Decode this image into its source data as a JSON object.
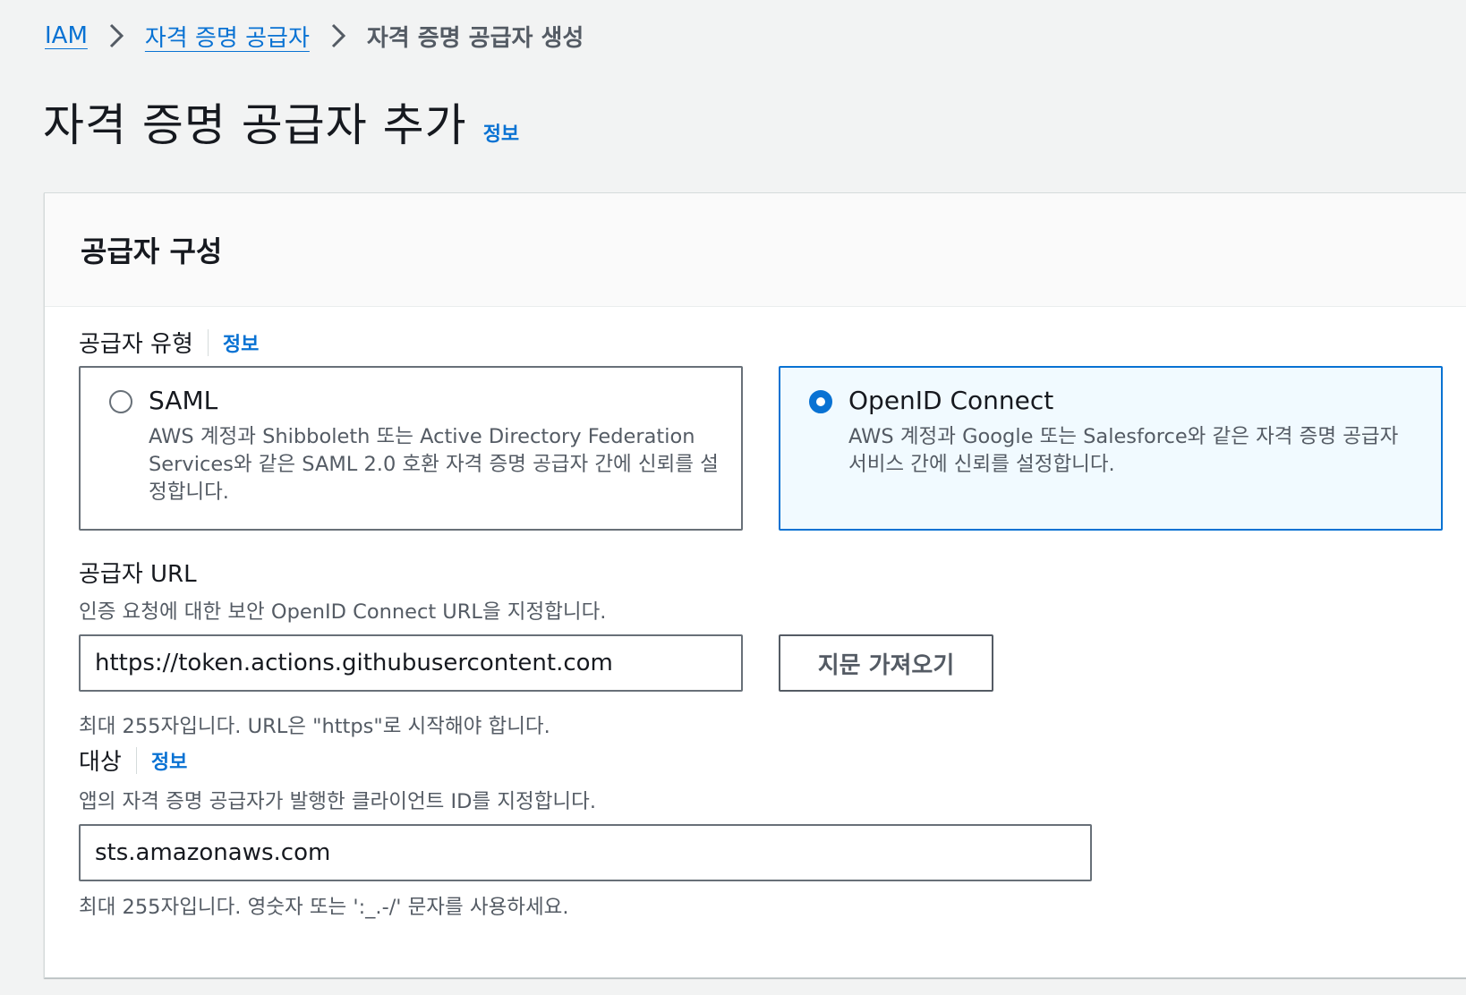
{
  "breadcrumb": {
    "items": [
      {
        "label": "IAM"
      },
      {
        "label": "자격 증명 공급자"
      }
    ],
    "current": "자격 증명 공급자 생성"
  },
  "page": {
    "title": "자격 증명 공급자 추가",
    "info_label": "정보"
  },
  "panel": {
    "title": "공급자 구성"
  },
  "provider_type": {
    "label": "공급자 유형",
    "info_label": "정보",
    "selected": "OpenID Connect",
    "options": [
      {
        "title": "SAML",
        "desc_line1": "AWS 계정과 Shibboleth 또는 Active Directory Federation",
        "desc_line2": "Services와 같은 SAML 2.0 호환 자격 증명 공급자 간에 신뢰를 설",
        "desc_line3": "정합니다."
      },
      {
        "title": "OpenID Connect",
        "desc_line1": "AWS 계정과 Google 또는 Salesforce와 같은 자격 증명 공급자",
        "desc_line2": "서비스 간에 신뢰를 설정합니다."
      }
    ]
  },
  "provider_url": {
    "label": "공급자 URL",
    "description": "인증 요청에 대한 보안 OpenID Connect URL을 지정합니다.",
    "value": "https://token.actions.githubusercontent.com",
    "hint": "최대 255자입니다. URL은 \"https\"로 시작해야 합니다.",
    "button_label": "지문 가져오기"
  },
  "audience": {
    "label": "대상",
    "info_label": "정보",
    "description": "앱의 자격 증명 공급자가 발행한 클라이언트 ID를 지정합니다.",
    "value": "sts.amazonaws.com",
    "hint": "최대 255자입니다. 영숫자 또는 ':_.-/' 문자를 사용하세요."
  },
  "colors": {
    "accent": "#0972d3",
    "text": "#16191f",
    "muted": "#545b64",
    "background": "#f2f3f3",
    "selected_tile_bg": "#f1faff"
  },
  "icons": {
    "breadcrumb_separator": "chevron-right-icon"
  }
}
